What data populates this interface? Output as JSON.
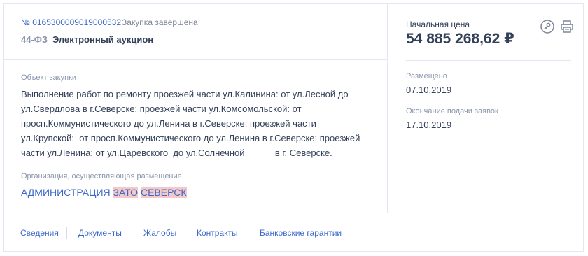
{
  "header": {
    "reg_number": "№ 0165300009019000532",
    "status": "Закупка завершена",
    "law": "44-ФЗ",
    "procedure_type": "Электронный аукцион"
  },
  "object": {
    "label": "Объект закупки",
    "text": "Выполнение работ по ремонту проезжей части ул.Калинина: от ул.Лесной до\nул.Свердлова в г.Северске; проезжей части ул.Комсомольской: от\nпросп.Коммунистического до ул.Ленина в г.Северске; проезжей части\nул.Крупской:  от просп.Коммунистического до ул.Ленина в г.Северске; проезжей\nчасти ул.Ленина: от ул.Царевского  до ул.Солнечной            в г. Северске."
  },
  "organization": {
    "label": "Организация, осуществляющая размещение",
    "name_part1": "АДМИНИСТРАЦИЯ",
    "name_part2": "ЗАТО",
    "name_part3": "СЕВЕРСК"
  },
  "price": {
    "label": "Начальная цена",
    "value": "54 885 268,62 ₽"
  },
  "dates": {
    "placed_label": "Размещено",
    "placed_value": "07.10.2019",
    "deadline_label": "Окончание подачи заявок",
    "deadline_value": "17.10.2019"
  },
  "icons": {
    "key": "key-icon",
    "print": "printer-icon"
  },
  "tabs": [
    {
      "label": "Сведения"
    },
    {
      "label": "Документы"
    },
    {
      "label": "Жалобы"
    },
    {
      "label": "Контракты"
    },
    {
      "label": "Банковские гарантии"
    }
  ],
  "colors": {
    "link": "#3c68c9",
    "highlight": "#f4c9c9",
    "text": "#334059",
    "muted": "#8a95ab"
  }
}
